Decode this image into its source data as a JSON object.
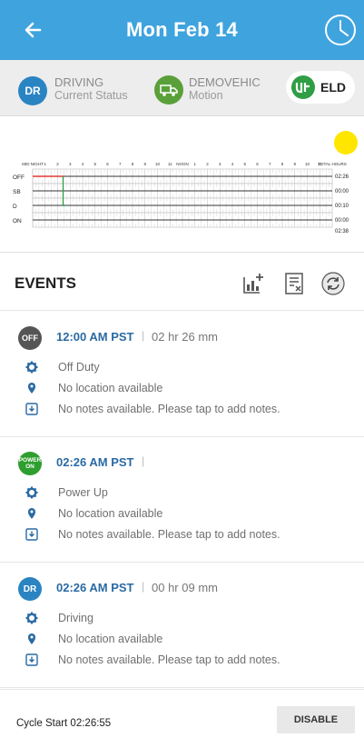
{
  "header": {
    "title": "Mon Feb 14"
  },
  "status": {
    "driver_badge": "DR",
    "driver_status": "DRIVING",
    "driver_sub": "Current Status",
    "vehicle_name": "DEMOVEHIC",
    "vehicle_sub": "Motion",
    "eld_label": "ELD"
  },
  "graph": {
    "rows": [
      "OFF",
      "SB",
      "D",
      "ON"
    ],
    "hour_labels": [
      "MID NIGHT",
      "1",
      "2",
      "3",
      "4",
      "5",
      "6",
      "7",
      "8",
      "9",
      "10",
      "11",
      "NOON",
      "1",
      "2",
      "3",
      "4",
      "5",
      "6",
      "7",
      "8",
      "9",
      "10",
      "11",
      "TOTAL HOURS"
    ],
    "totals": [
      "02:26",
      "00:00",
      "00:10",
      "00:00",
      "02:38"
    ]
  },
  "events_section": {
    "title": "EVENTS"
  },
  "events": [
    {
      "badge": "OFF",
      "badge_color": "#555555",
      "time": "12:00 AM PST",
      "duration": "02 hr 26 mm",
      "type": "Off Duty",
      "location": "No location available",
      "notes": "No notes available. Please tap to add notes."
    },
    {
      "badge": "POWER ON",
      "badge_color": "#2e9e2e",
      "time": "02:26 AM PST",
      "duration": "",
      "type": "Power Up",
      "location": "No location available",
      "notes": "No notes available. Please tap to add notes."
    },
    {
      "badge": "DR",
      "badge_color": "#2a84c2",
      "time": "02:26 AM PST",
      "duration": "00 hr 09 mm",
      "type": "Driving",
      "location": "No location available",
      "notes": "No notes available. Please tap to add notes."
    }
  ],
  "footer": {
    "cycle_start": "Cycle Start 02:26:55",
    "disable_label": "DISABLE"
  },
  "colors": {
    "header_bg": "#3fa3de",
    "off_line": "#e53935",
    "driving_line": "#2e9e44",
    "indicator": "#ffe600"
  }
}
